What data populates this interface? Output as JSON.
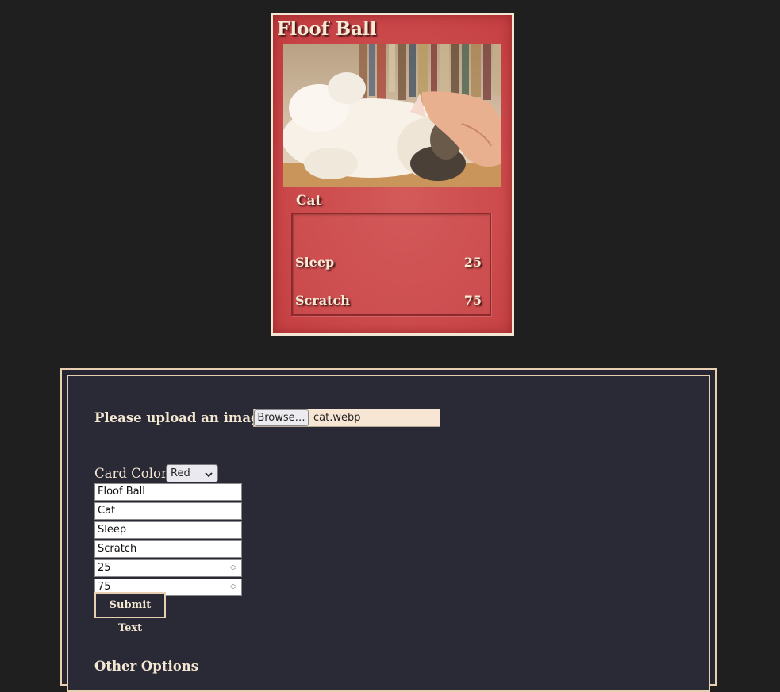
{
  "card": {
    "title": "Floof Ball",
    "type": "Cat",
    "stats": [
      {
        "name": "Sleep",
        "value": "25"
      },
      {
        "name": "Scratch",
        "value": "75"
      }
    ]
  },
  "form": {
    "upload_label": "Please upload an image!",
    "browse_label": "Browse…",
    "file_name": "cat.webp",
    "color_label": "Card Color:",
    "color_selected": "Red",
    "fields": {
      "title": "Floof Ball",
      "type": "Cat",
      "stat1_name": "Sleep",
      "stat2_name": "Scratch",
      "stat1_value": "25",
      "stat2_value": "75"
    },
    "submit_label": "Submit Text",
    "other_heading": "Other Options"
  },
  "colors": {
    "background": "#1f1f1f",
    "card_red": "#cc4a4c",
    "card_border": "#f3e6d4",
    "panel": "#2a2936",
    "panel_border": "#e9cfb2",
    "file_field": "#f8e6d4"
  }
}
